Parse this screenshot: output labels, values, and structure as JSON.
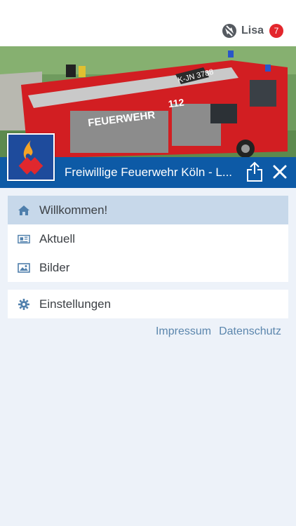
{
  "user": {
    "name": "Lisa",
    "badge_count": "7"
  },
  "org": {
    "title": "Freiwillige Feuerwehr Köln - L..."
  },
  "hero": {
    "door_text": "FEUERWEHR",
    "emergency_number": "112",
    "roof_plate": "K-JN 3788"
  },
  "menu": {
    "main": [
      {
        "label": "Willkommen!",
        "icon": "home-icon",
        "active": true
      },
      {
        "label": "Aktuell",
        "icon": "newspaper-icon",
        "active": false
      },
      {
        "label": "Bilder",
        "icon": "image-icon",
        "active": false
      }
    ],
    "settings": {
      "label": "Einstellungen",
      "icon": "gear-icon"
    }
  },
  "footer": {
    "impressum": "Impressum",
    "datenschutz": "Datenschutz"
  },
  "colors": {
    "brand_blue": "#0d5aa6",
    "active_row": "#c7d8ea",
    "badge_red": "#e3262c",
    "link": "#5b86ad"
  }
}
